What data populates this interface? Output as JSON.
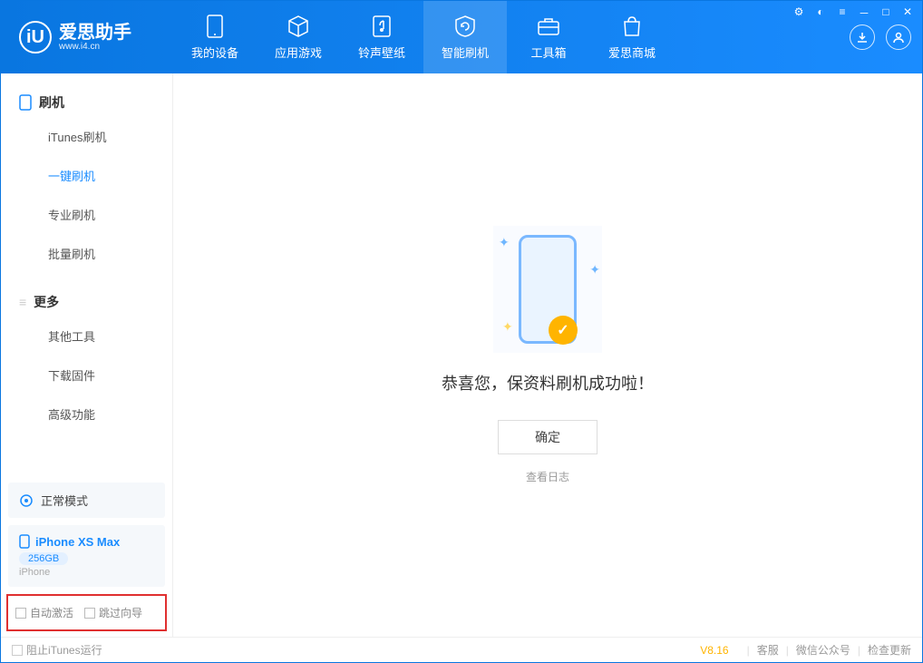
{
  "app": {
    "name": "爱思助手",
    "url": "www.i4.cn"
  },
  "nav": {
    "tabs": [
      "我的设备",
      "应用游戏",
      "铃声壁纸",
      "智能刷机",
      "工具箱",
      "爱思商城"
    ],
    "activeIndex": 3
  },
  "sidebar": {
    "section1": {
      "title": "刷机",
      "items": [
        "iTunes刷机",
        "一键刷机",
        "专业刷机",
        "批量刷机"
      ],
      "activeIndex": 1
    },
    "section2": {
      "title": "更多",
      "items": [
        "其他工具",
        "下载固件",
        "高级功能"
      ]
    },
    "mode": "正常模式",
    "device": {
      "name": "iPhone XS Max",
      "capacity": "256GB",
      "type": "iPhone"
    },
    "checkboxes": {
      "autoActivate": "自动激活",
      "skipGuide": "跳过向导"
    }
  },
  "main": {
    "message": "恭喜您，保资料刷机成功啦！",
    "okButton": "确定",
    "logLink": "查看日志"
  },
  "footer": {
    "blockItunes": "阻止iTunes运行",
    "version": "V8.16",
    "links": [
      "客服",
      "微信公众号",
      "检查更新"
    ]
  }
}
